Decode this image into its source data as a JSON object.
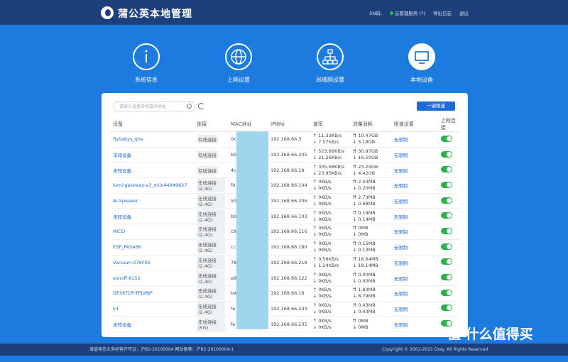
{
  "header": {
    "brand": "蒲公英本地管理",
    "sn_label": "SN码:",
    "cloud_label": "云管理服务 (?)",
    "export_label": "导出日志",
    "logout_label": "退出"
  },
  "nav": [
    {
      "label": "系统信息",
      "icon": "info-icon"
    },
    {
      "label": "上网设置",
      "icon": "globe-icon"
    },
    {
      "label": "局域网设置",
      "icon": "network-icon"
    },
    {
      "label": "本地设备",
      "icon": "monitor-icon"
    }
  ],
  "search": {
    "placeholder": "请输入设备名称或IP地址"
  },
  "quick_button": "一键限速",
  "columns": [
    "设备",
    "连接",
    "MAC地址",
    "IP地址",
    "速率",
    "流量消耗",
    "限速设置",
    "上网连接"
  ],
  "rows": [
    {
      "device": "flybabys_qhe",
      "conn": "有线连接",
      "mac": "0c",
      "ip": "192.168.66.3",
      "up": "↑ 11.33KB/s",
      "down": "↓ 7.57KB/s",
      "tu": "⇈ 10.47GB",
      "td": "↓ 5.18GB",
      "limit": "无限制"
    },
    {
      "device": "未知设备",
      "conn": "有线连接",
      "mac": "b0",
      "ip": "192.168.66.205",
      "up": "↑ 523.66KB/s",
      "down": "↓ 21.26KB/s",
      "tu": "⇈ 30.97GB",
      "td": "↓ 16.50GB",
      "limit": "无限制"
    },
    {
      "device": "未知设备",
      "conn": "有线连接",
      "mac": "4c",
      "ip": "192.168.66.18",
      "up": "↑ 305.68KB/s",
      "down": "↓ 23.95KB/s",
      "tu": "⇈ 23.29GB",
      "td": "↓ 4.42GB",
      "limit": "无限制"
    },
    {
      "device": "lumi-gateway-v3_miio44849627",
      "conn": "无线连接(2.4G)",
      "mac": "f0",
      "ip": "192.168.66.104",
      "up": "↑ 0KB/s",
      "down": "↓ 0KB/s",
      "tu": "⇈ 2.43MB",
      "td": "↓ 0.20MB",
      "limit": "无限制"
    },
    {
      "device": "AI-Speaker",
      "conn": "无线连接(2.4G)",
      "mac": "50",
      "ip": "192.168.66.206",
      "up": "↑ 0KB/s",
      "down": "↓ 0KB/s",
      "tu": "⇈ 2.73MB",
      "td": "↓ 0.68MB",
      "limit": "无限制"
    },
    {
      "device": "未知设备",
      "conn": "无线连接(2.4G)",
      "mac": "b0",
      "ip": "192.168.66.103",
      "up": "↑ 0KB/s",
      "down": "↓ 0KB/s",
      "tu": "⇈ 0.19MB",
      "td": "↓ 0.14MB",
      "limit": "无限制"
    },
    {
      "device": "MiCO",
      "conn": "无线连接(2.4G)",
      "mac": "c8",
      "ip": "192.168.66.116",
      "up": "↑ 0KB/s",
      "down": "↓ 0KB/s",
      "tu": "⇈ 0MB",
      "td": "↓ 0MB",
      "limit": "无限制"
    },
    {
      "device": "ESP_FA5A66",
      "conn": "无线连接(2.4G)",
      "mac": "cc",
      "ip": "192.168.66.180",
      "up": "↑ 0KB/s",
      "down": "↓ 0KB/s",
      "tu": "⇈ 0.15MB",
      "td": "↓ 0.13MB",
      "limit": "无限制"
    },
    {
      "device": "Vacuum-076F06",
      "conn": "无线连接(2.4G)",
      "mac": "78",
      "ip": "192.168.66.218",
      "up": "↑ 0.56KB/s",
      "down": "↓ 1.24KB/s",
      "tu": "⇈ 18.64MB",
      "td": "↓ 18.14MB",
      "limit": "无限制"
    },
    {
      "device": "sonoff-6152",
      "conn": "无线连接(2.4G)",
      "mac": "e8",
      "ip": "192.168.66.122",
      "up": "↑ 0KB/s",
      "down": "↓ 0KB/s",
      "tu": "⇈ 0.00MB",
      "td": "↓ 0.00MB",
      "limit": "无限制"
    },
    {
      "device": "DESKTOP-TPJV8JP",
      "conn": "无线连接(2.4G)",
      "mac": "b4",
      "ip": "192.168.66.16",
      "up": "↑ 0KB/s",
      "down": "↓ 0KB/s",
      "tu": "⇈ 1.83MB",
      "td": "↓ 8.79MB",
      "limit": "无限制"
    },
    {
      "device": "E1",
      "conn": "无线连接(2.4G)",
      "mac": "fe",
      "ip": "192.168.66.233",
      "up": "↑ 0KB/s",
      "down": "↓ 0KB/s",
      "tu": "⇈ 0.43MB",
      "td": "↓ 0.43MB",
      "limit": "无限制"
    },
    {
      "device": "未知设备",
      "conn": "无线连接(5G)",
      "mac": "fe",
      "ip": "192.168.66.235",
      "up": "↑ 0KB/s",
      "down": "↓ 0KB/s",
      "tu": "⇈ 0MB",
      "td": "↓ 0MB",
      "limit": "无限制"
    }
  ],
  "footer": {
    "license": "增值电信业务经营许可证：沪B2-20100004 网站备案：沪B2-20100004-1",
    "copyright": "Copyright © 2002-2021 Oray. All Rights Reserved",
    "watermark": "值 什么值得买"
  }
}
